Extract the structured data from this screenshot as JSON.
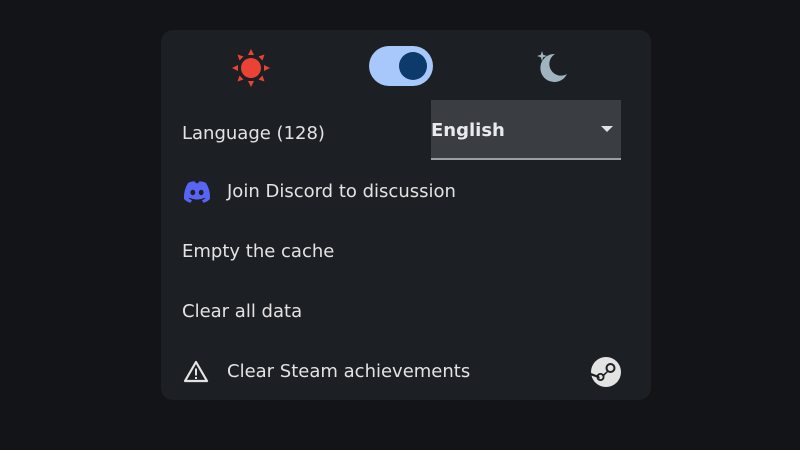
{
  "theme": {
    "light_icon": "sun-icon",
    "dark_icon": "moon-icon",
    "toggle_state": "dark",
    "colors": {
      "sun": "#ea4335",
      "toggle_track": "#a8c7fa",
      "toggle_knob": "#0b3a6b",
      "moon": "#a0b4c0"
    }
  },
  "language": {
    "label": "Language (128)",
    "selected": "English"
  },
  "discord": {
    "icon": "discord-icon",
    "label": "Join Discord to discussion",
    "color": "#5865f2"
  },
  "cache": {
    "label": "Empty the cache"
  },
  "clear_data": {
    "label": "Clear all data"
  },
  "steam": {
    "warning_icon": "warning-icon",
    "label": "Clear Steam achievements",
    "logo_icon": "steam-icon"
  }
}
